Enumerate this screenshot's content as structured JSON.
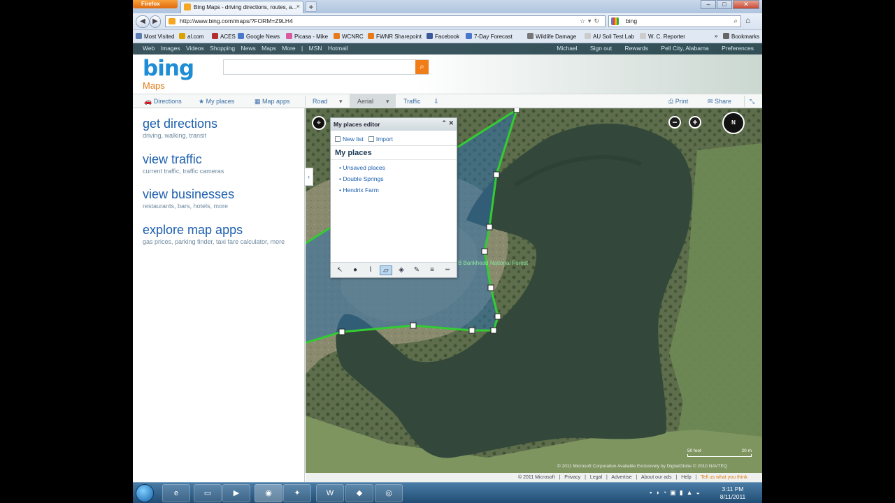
{
  "browser": {
    "menu_button": "Firefox",
    "tab_title": "Bing Maps - driving directions, routes, a...",
    "url": "http://www.bing.com/maps/?FORM=Z9LH4",
    "search_value": "bing",
    "bookmarks": [
      {
        "label": "Most Visited",
        "color": "#5a7fb0"
      },
      {
        "label": "al.com",
        "color": "#d9a400"
      },
      {
        "label": "ACES",
        "color": "#b03030"
      },
      {
        "label": "Google News",
        "color": "#4a77c9"
      },
      {
        "label": "Picasa - Mike",
        "color": "#d95b9d"
      },
      {
        "label": "WCNRC",
        "color": "#e87a1e"
      },
      {
        "label": "FWNR Sharepoint",
        "color": "#e87a1e"
      },
      {
        "label": "Facebook",
        "color": "#3b5998"
      },
      {
        "label": "7-Day Forecast",
        "color": "#4a77c9"
      },
      {
        "label": "Wildlife Damage",
        "color": "#777777"
      },
      {
        "label": "AU Soil Test Lab",
        "color": "#cccccc"
      },
      {
        "label": "W. C. Reporter",
        "color": "#cccccc"
      },
      {
        "label": "Bookmarks",
        "color": "#666666"
      }
    ]
  },
  "bing": {
    "topnav": [
      "Web",
      "Images",
      "Videos",
      "Shopping",
      "News",
      "Maps",
      "More",
      "|",
      "MSN",
      "Hotmail"
    ],
    "topright": [
      "Michael",
      "Sign out",
      "Rewards",
      "Pell City, Alabama",
      "Preferences"
    ],
    "logo": "bing",
    "maps_label": "Maps",
    "search_placeholder": ""
  },
  "toolbar": {
    "directions": "Directions",
    "my_places": "My places",
    "map_apps": "Map apps",
    "road": "Road",
    "aerial": "Aerial",
    "traffic": "Traffic",
    "print": "Print",
    "share": "Share"
  },
  "left_panel": [
    {
      "heading": "get directions",
      "sub": "driving, walking, transit"
    },
    {
      "heading": "view traffic",
      "sub": "current traffic, traffic cameras"
    },
    {
      "heading": "view businesses",
      "sub": "restaurants, bars, hotels, more"
    },
    {
      "heading": "explore map apps",
      "sub": "gas prices, parking finder, taxi fare calculator, more"
    }
  ],
  "editor": {
    "title": "My places editor",
    "new_list": "New list",
    "import": "Import",
    "heading": "My places",
    "places": [
      "• Unsaved places",
      "• Double Springs",
      "• Hendrix Farm"
    ]
  },
  "map": {
    "forest_label": "B Bankhead National Forest",
    "compass_label": "N",
    "scale_left": "50 feet",
    "scale_right": "20 m",
    "credit": "© 2011 Microsoft Corporation   Available Exclusively by DigitalGlobe © 2010 NAVTEQ",
    "polygon_fill": "#2f6fa8",
    "polygon_stroke": "#33cc33"
  },
  "footer": [
    "© 2011 Microsoft",
    "|",
    "Privacy",
    "|",
    "Legal",
    "|",
    "Advertise",
    "|",
    "About our ads",
    "|",
    "Help",
    "|",
    "Tell us what you think"
  ],
  "taskbar": {
    "time": "3:11 PM",
    "date": "8/11/2011"
  }
}
